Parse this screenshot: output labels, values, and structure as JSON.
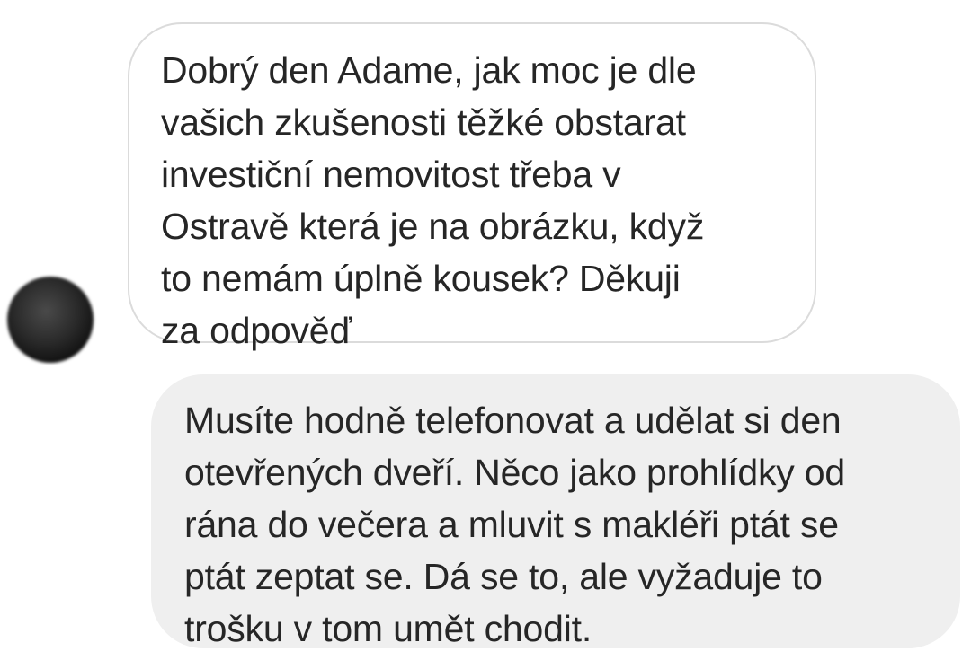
{
  "conversation": {
    "messages": [
      {
        "sender": "other",
        "text": "Dobrý den Adame, jak moc je dle\nvašich zkušenosti těžké obstarat\ninvestiční nemovitost třeba v\nOstravě která je na obrázku, když\nto nemám úplně kousek? Děkuji\nza odpověď"
      },
      {
        "sender": "me",
        "text": "Musíte hodně telefonovat a udělat si den\notevřených dveří. Něco jako prohlídky od\nrána do večera a mluvit s makléři ptát se\nptát zeptat se. Dá se to, ale vyžaduje to\ntrošku v tom umět chodit."
      }
    ]
  },
  "colors": {
    "incoming_bubble_border": "#dbdbdb",
    "outgoing_bubble_background": "#efefef",
    "text": "#262626"
  }
}
